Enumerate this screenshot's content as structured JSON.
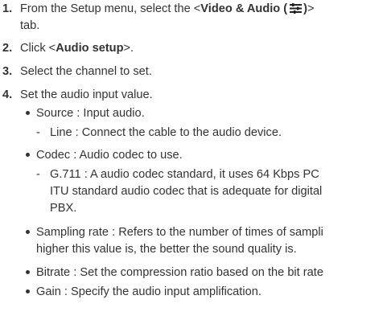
{
  "steps": {
    "s1": {
      "number": "1.",
      "text_a": "From the Setup menu, select the <",
      "bold": "Video & Audio (",
      "bold_close": ")",
      "text_b": ">",
      "cont": "tab.",
      "icon": "settings-sliders-icon"
    },
    "s2": {
      "number": "2.",
      "text_a": "Click <",
      "bold": "Audio setup",
      "text_b": ">."
    },
    "s3": {
      "number": "3.",
      "text": "Select the channel to set."
    },
    "s4": {
      "number": "4.",
      "text": "Set the audio input value."
    }
  },
  "items": {
    "source": "Source : Input audio.",
    "line": "Line : Connect the cable to the audio device.",
    "codec": "Codec : Audio codec to use.",
    "g711_1": "G.711 : A audio codec standard, it uses 64 Kbps PC",
    "g711_2": "ITU standard audio codec that is adequate for digital",
    "g711_3": "PBX.",
    "sampling_1": "Sampling rate : Refers to the number of times of sampli",
    "sampling_2": "higher this value is, the better the sound quality is.",
    "bitrate": "Bitrate : Set the compression ratio based on the bit rate",
    "gain": "Gain : Specify the audio input amplification."
  }
}
